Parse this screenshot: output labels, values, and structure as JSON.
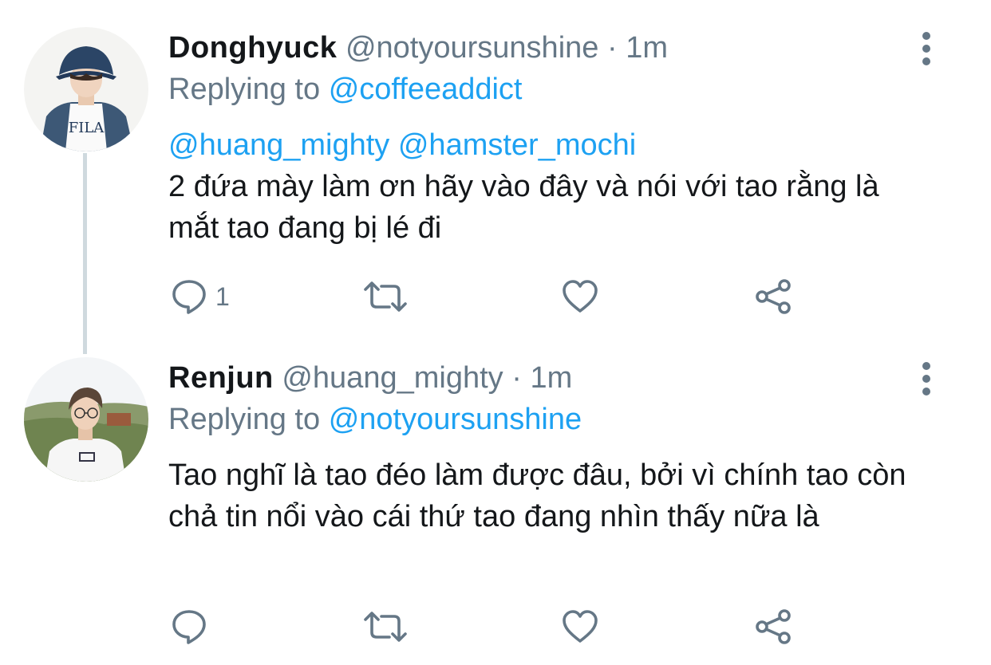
{
  "tweets": [
    {
      "display_name": "Donghyuck",
      "handle": "@notyoursunshine",
      "separator": "·",
      "time": "1m",
      "replying_prefix": "Replying to",
      "replying_to": "@coffeeaddict",
      "mentions": "@huang_mighty @hamster_mochi",
      "text": "2 đứa mày làm ơn hãy vào đây và nói với tao rằng là mắt tao đang bị lé đi",
      "reply_count": "1"
    },
    {
      "display_name": "Renjun",
      "handle": "@huang_mighty",
      "separator": "·",
      "time": "1m",
      "replying_prefix": "Replying to",
      "replying_to": "@notyoursunshine",
      "text": "Tao nghĩ là tao đéo làm được đâu, bởi vì chính tao còn chả tin nổi vào cái thứ tao đang nhìn thấy nữa là",
      "reply_count": ""
    }
  ],
  "icons": {
    "more": "more-vertical-icon",
    "reply": "reply-icon",
    "retweet": "retweet-icon",
    "like": "like-icon",
    "share": "share-icon"
  },
  "colors": {
    "link": "#1da1f2",
    "secondary_text": "#657786",
    "icon": "#657786",
    "thread_line": "#cfd9de"
  }
}
